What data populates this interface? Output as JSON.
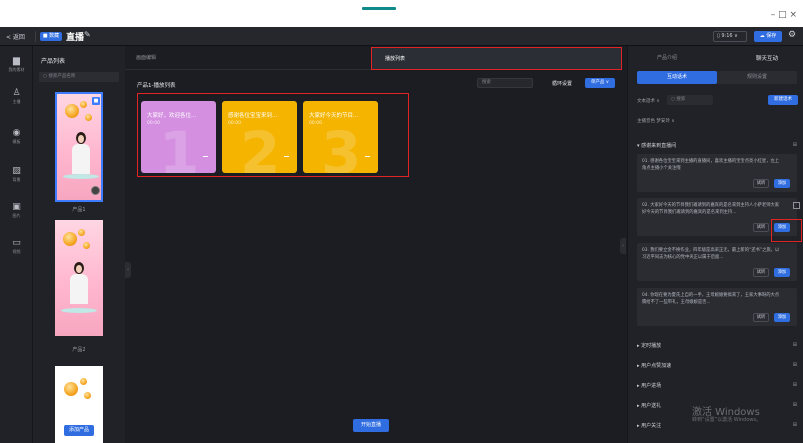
{
  "window": {
    "controls": "– □ ×"
  },
  "toolbar": {
    "back": "< 返回",
    "badge": "■ 数藏",
    "live_name": "直播",
    "edit_icon": "✎",
    "ratio": "▯ 9:16 ∨",
    "save": "☁ 保存",
    "settings_icon": "⚙"
  },
  "leftnav": [
    {
      "icon": "▆",
      "label": "我的素材"
    },
    {
      "icon": "♙",
      "label": "主播"
    },
    {
      "icon": "◉",
      "label": "模板"
    },
    {
      "icon": "▨",
      "label": "背景"
    },
    {
      "icon": "▣",
      "label": "图片"
    },
    {
      "icon": "▭",
      "label": "视频"
    }
  ],
  "product_list": {
    "title": "产品列表",
    "search_placeholder": "○ 搜索产品名称",
    "items": [
      {
        "label": "产品1"
      },
      {
        "label": "产品2"
      }
    ],
    "add_button": "添加产品"
  },
  "center": {
    "tab_edit": "画面编辑",
    "tab_playlist": "播放列表",
    "playlist_title": "产品1-播放列表",
    "search_placeholder": "搜索",
    "loop_label": "循环设置",
    "loop_value": "单产品 ∨",
    "cards": [
      {
        "title": "大家好，欢迎各位...",
        "time": "00:00",
        "number": "1",
        "color": "#d48fe0"
      },
      {
        "title": "感谢各位宝宝来到...",
        "time": "00:00",
        "number": "2",
        "color": "#f4b400"
      },
      {
        "title": "大家好今天的节目...",
        "time": "00:00",
        "number": "3",
        "color": "#f4b400"
      }
    ],
    "start_live": "开始直播"
  },
  "right": {
    "tab_product": "产品介绍",
    "tab_interact": "聊天互动",
    "seg_interact": "互动话术",
    "seg_rules": "规则设置",
    "filter_label": "文本話术 ∨",
    "search_placeholder": "○ 搜索",
    "new_button": "新建话术",
    "anchor_label": "主播音色   梦安玲   ∨",
    "section_welcome": "▾ 感谢来到直播间",
    "scripts": [
      {
        "text": "01. 感谢各位宝宝来到主播的直播间，喜欢主播的宝宝点亮小红星，左上角点主播小个关注哦",
        "test": "试听",
        "add": "添加"
      },
      {
        "text": "02. 大家好今天的节目我们邀请到的嘉宾的是名来到主持人小萨老师大家好今天的节目我们邀请到的嘉宾的是名来到主持...",
        "test": "试听",
        "add": "添加"
      },
      {
        "text": "03. 我们要立金不换作业，四年级是高采正无，最上新的“还书”之旅，以习近平同志为核心的党中央正以属于后面...",
        "test": "试听",
        "add": "添加"
      },
      {
        "text": "04. 你现在要为夏氏上自的一手，王母娘娘要搞来了，王家大事呀的大点腾给不了一些带礼，王母娘娘是否...",
        "test": "试听",
        "add": "添加"
      }
    ],
    "sections": [
      "▸ 定时播放",
      "▸ 用户点赞加速",
      "▸ 用户进场",
      "▸ 用户送礼",
      "▸ 用户关注"
    ],
    "plus": "⊞"
  },
  "watermark": {
    "line1": "激活 Windows",
    "line2": "转到“设置”以激活 Windows。"
  }
}
